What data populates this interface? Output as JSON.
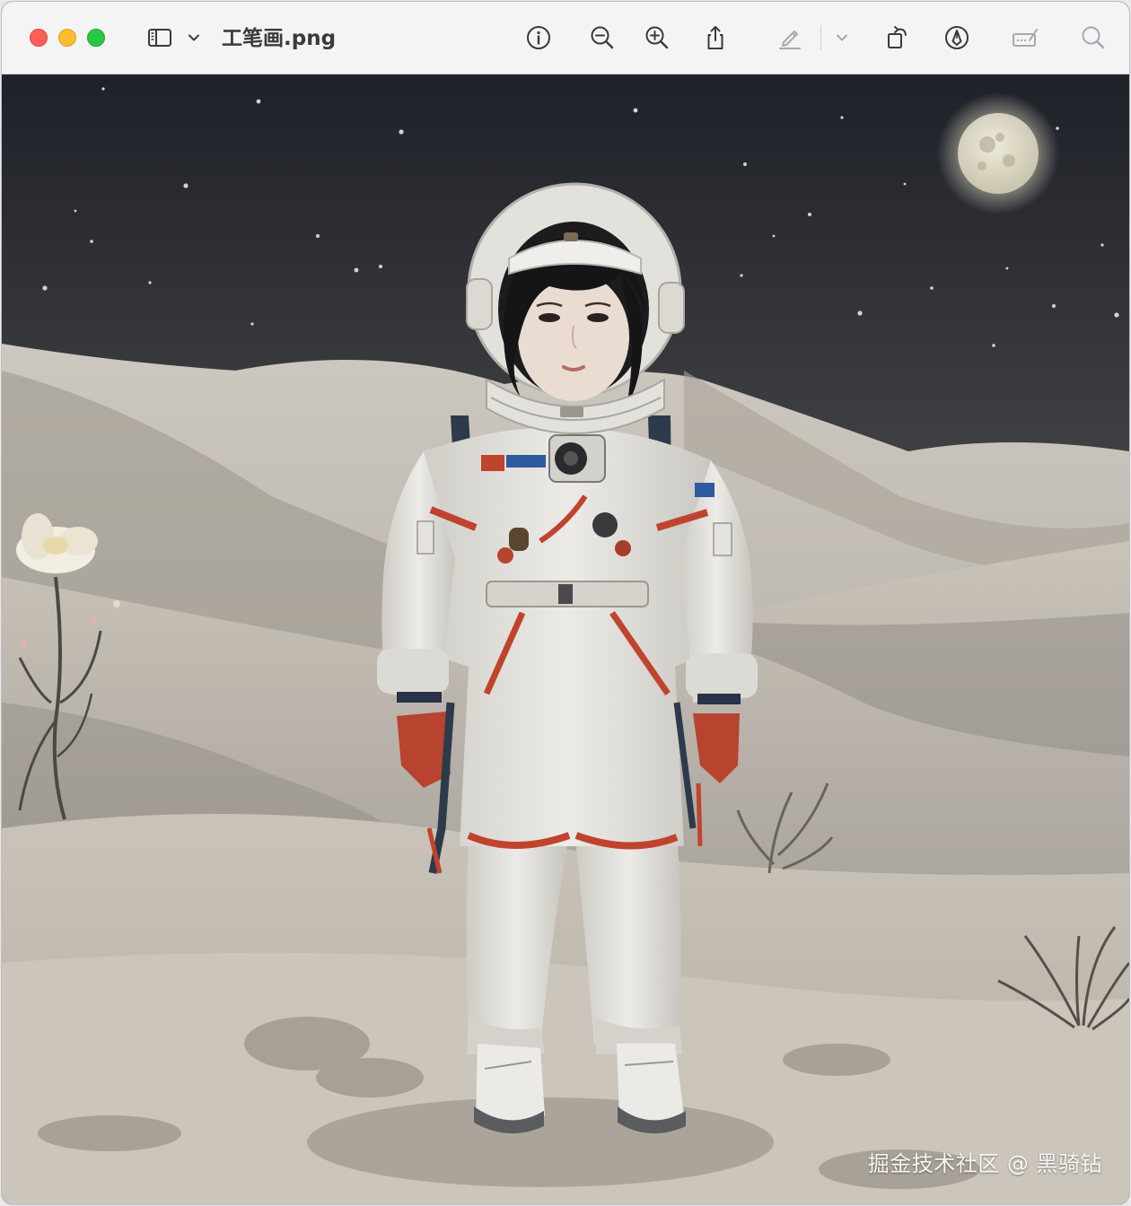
{
  "window": {
    "title": "工笔画.png"
  },
  "toolbar": {
    "buttons": [
      {
        "name": "sidebar-toggle",
        "icon": "sidebar-icon"
      },
      {
        "name": "sidebar-menu",
        "icon": "chevron-down-icon"
      },
      {
        "name": "info",
        "icon": "info-icon"
      },
      {
        "name": "zoom-out",
        "icon": "zoom-out-icon"
      },
      {
        "name": "zoom-in",
        "icon": "zoom-in-icon"
      },
      {
        "name": "share",
        "icon": "share-icon"
      },
      {
        "name": "markup",
        "icon": "pencil-icon"
      },
      {
        "name": "markup-menu",
        "icon": "chevron-down-icon"
      },
      {
        "name": "rotate",
        "icon": "rotate-icon"
      },
      {
        "name": "markup-pen",
        "icon": "pen-circle-icon"
      },
      {
        "name": "form-fill",
        "icon": "signature-icon"
      },
      {
        "name": "search",
        "icon": "search-icon"
      }
    ]
  },
  "image": {
    "watermark": "掘金技术社区 @ 黑骑钻"
  },
  "colors": {
    "toolbar_bg": "#f4f4f5",
    "icon": "#3a3a3c",
    "icon_disabled": "#a8a8ad",
    "sky": "#1e2128",
    "sand": "#bdb7ae",
    "suit": "#e7e5e0",
    "suit_accent": "#c0432e"
  }
}
